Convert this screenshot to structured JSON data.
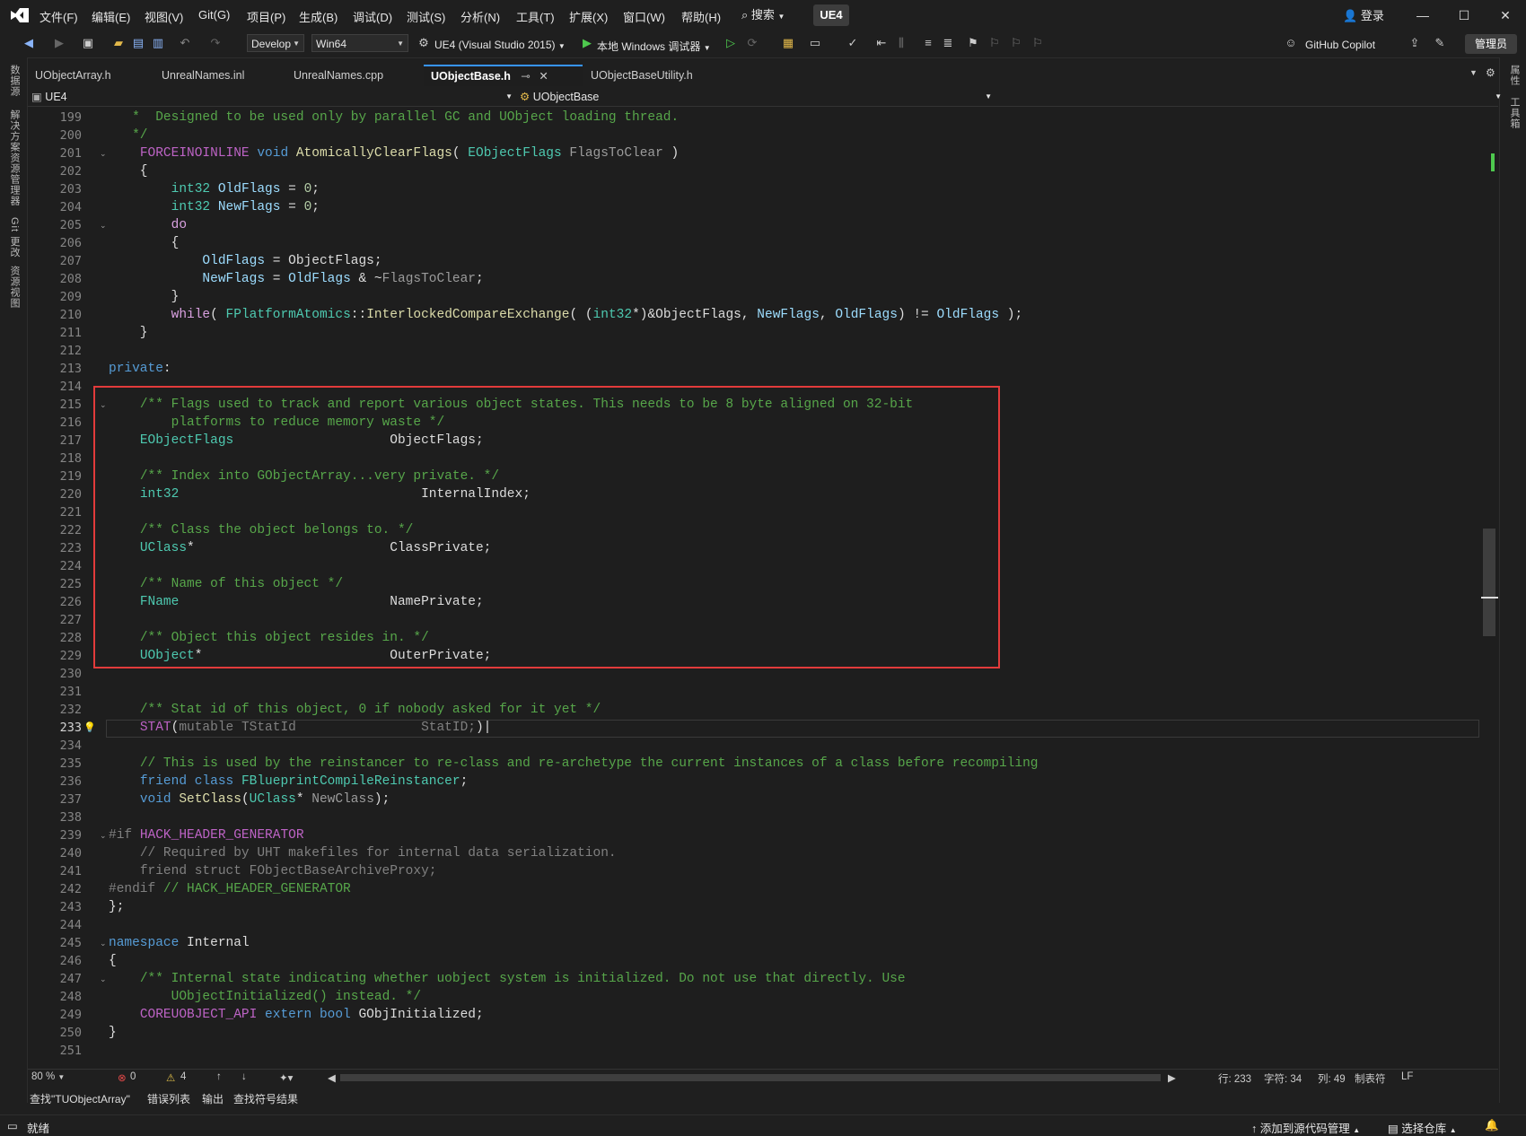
{
  "menu": [
    "文件(F)",
    "编辑(E)",
    "视图(V)",
    "Git(G)",
    "项目(P)",
    "生成(B)",
    "调试(D)",
    "测试(S)",
    "分析(N)",
    "工具(T)",
    "扩展(X)",
    "窗口(W)",
    "帮助(H)"
  ],
  "search_label": "搜索",
  "solution_badge": "UE4",
  "login_label": "登录",
  "toolbar": {
    "config": "Develop",
    "platform": "Win64",
    "project": "UE4 (Visual Studio 2015)",
    "debugger": "本地 Windows 调试器",
    "copilot": "GitHub Copilot",
    "admin": "管理员"
  },
  "left_strip": [
    "数据源",
    "解决方案资源管理器",
    "Git 更改",
    "资源视图"
  ],
  "right_strip": [
    "属性",
    "工具箱"
  ],
  "tabs": [
    "UObjectArray.h",
    "UnrealNames.inl",
    "UnrealNames.cpp",
    "UObjectBase.h",
    "UObjectBaseUtility.h"
  ],
  "nav": {
    "project": "UE4",
    "scope": "UObjectBase"
  },
  "lines": [
    {
      "n": "199",
      "h": "   <span class='c'>*  Designed to be used only by parallel GC and UObject loading thread.</span>"
    },
    {
      "n": "200",
      "h": "   <span class='c'>*/</span>"
    },
    {
      "n": "201",
      "h": "    <span class='ma'>FORCEINOINLINE</span> <span class='k'>void</span> <span class='f'>AtomicallyClearFlags</span>( <span class='t'>EObjectFlags</span> <span class='g'>FlagsToClear</span> )",
      "fold": true
    },
    {
      "n": "202",
      "h": "    {"
    },
    {
      "n": "203",
      "h": "        <span class='t'>int32</span> <span class='v'>OldFlags</span> = <span class='n'>0</span>;"
    },
    {
      "n": "204",
      "h": "        <span class='t'>int32</span> <span class='v'>NewFlags</span> = <span class='n'>0</span>;"
    },
    {
      "n": "205",
      "h": "        <span class='p'>do</span>",
      "fold": true
    },
    {
      "n": "206",
      "h": "        {"
    },
    {
      "n": "207",
      "h": "            <span class='v'>OldFlags</span> = ObjectFlags;"
    },
    {
      "n": "208",
      "h": "            <span class='v'>NewFlags</span> = <span class='v'>OldFlags</span> &amp; ~<span class='g'>FlagsToClear</span>;"
    },
    {
      "n": "209",
      "h": "        }"
    },
    {
      "n": "210",
      "h": "        <span class='p'>while</span>( <span class='t'>FPlatformAtomics</span>::<span class='f'>InterlockedCompareExchange</span>( (<span class='t'>int32</span>*)&amp;ObjectFlags, <span class='v'>NewFlags</span>, <span class='v'>OldFlags</span>) != <span class='v'>OldFlags</span> );"
    },
    {
      "n": "211",
      "h": "    }"
    },
    {
      "n": "212",
      "h": ""
    },
    {
      "n": "213",
      "h": "<span class='k'>private</span>:"
    },
    {
      "n": "214",
      "h": ""
    },
    {
      "n": "215",
      "h": "    <span class='c'>/** Flags used to track and report various object states. This needs to be 8 byte aligned on 32-bit</span>",
      "fold": true
    },
    {
      "n": "216",
      "h": "        <span class='c'>platforms to reduce memory waste */</span>"
    },
    {
      "n": "217",
      "h": "    <span class='t'>EObjectFlags</span>                    ObjectFlags;"
    },
    {
      "n": "218",
      "h": ""
    },
    {
      "n": "219",
      "h": "    <span class='c'>/** Index into GObjectArray...very private. */</span>"
    },
    {
      "n": "220",
      "h": "    <span class='t'>int32</span>                               InternalIndex;"
    },
    {
      "n": "221",
      "h": ""
    },
    {
      "n": "222",
      "h": "    <span class='c'>/** Class the object belongs to. */</span>"
    },
    {
      "n": "223",
      "h": "    <span class='t'>UClass</span>*                         ClassPrivate;"
    },
    {
      "n": "224",
      "h": ""
    },
    {
      "n": "225",
      "h": "    <span class='c'>/** Name of this object */</span>"
    },
    {
      "n": "226",
      "h": "    <span class='t'>FName</span>                           NamePrivate;"
    },
    {
      "n": "227",
      "h": ""
    },
    {
      "n": "228",
      "h": "    <span class='c'>/** Object this object resides in. */</span>"
    },
    {
      "n": "229",
      "h": "    <span class='t'>UObject</span>*                        OuterPrivate;"
    },
    {
      "n": "230",
      "h": ""
    },
    {
      "n": "231",
      "h": ""
    },
    {
      "n": "232",
      "h": "    <span class='c'>/** Stat id of this object, 0 if nobody asked for it yet */</span>"
    },
    {
      "n": "233",
      "h": "    <span class='ma'>STAT</span>(<span class='d'>mutable TStatId                StatID;</span>)|",
      "cur": true
    },
    {
      "n": "234",
      "h": ""
    },
    {
      "n": "235",
      "h": "    <span class='c'>// This is used by the reinstancer to re-class and re-archetype the current instances of a class before recompiling</span>"
    },
    {
      "n": "236",
      "h": "    <span class='k'>friend class</span> <span class='t'>FBlueprintCompileReinstancer</span>;"
    },
    {
      "n": "237",
      "h": "    <span class='k'>void</span> <span class='f'>SetClass</span>(<span class='t'>UClass</span>* <span class='g'>NewClass</span>);"
    },
    {
      "n": "238",
      "h": ""
    },
    {
      "n": "239",
      "h": "<span class='d'>#if</span> <span class='ma'>HACK_HEADER_GENERATOR</span>",
      "fold": true
    },
    {
      "n": "240",
      "h": "    <span class='d'>// Required by UHT makefiles for internal data serialization.</span>"
    },
    {
      "n": "241",
      "h": "    <span class='d'>friend struct FObjectBaseArchiveProxy;</span>"
    },
    {
      "n": "242",
      "h": "<span class='d'>#endif</span> <span class='c'>// HACK_HEADER_GENERATOR</span>"
    },
    {
      "n": "243",
      "h": "};"
    },
    {
      "n": "244",
      "h": ""
    },
    {
      "n": "245",
      "h": "<span class='k'>namespace</span> Internal",
      "fold": true
    },
    {
      "n": "246",
      "h": "{"
    },
    {
      "n": "247",
      "h": "    <span class='c'>/** Internal state indicating whether uobject system is initialized. Do not use that directly. Use</span>",
      "fold": true
    },
    {
      "n": "248",
      "h": "        <span class='c'>UObjectInitialized() instead. */</span>"
    },
    {
      "n": "249",
      "h": "    <span class='ma'>COREUOBJECT_API</span> <span class='k'>extern bool</span> GObjInitialized;"
    },
    {
      "n": "250",
      "h": "}"
    },
    {
      "n": "251",
      "h": ""
    }
  ],
  "editor_status": {
    "zoom": "80 %",
    "errors": "0",
    "warnings": "4",
    "row": "行: 233",
    "char": "字符: 34",
    "col": "列: 49",
    "indent": "制表符",
    "eol": "LF"
  },
  "tool_windows": [
    "查找\"TUObjectArray\"",
    "错误列表",
    "输出",
    "查找符号结果"
  ],
  "status": {
    "ready": "就绪",
    "add_source": "添加到源代码管理",
    "select_repo": "选择仓库"
  }
}
